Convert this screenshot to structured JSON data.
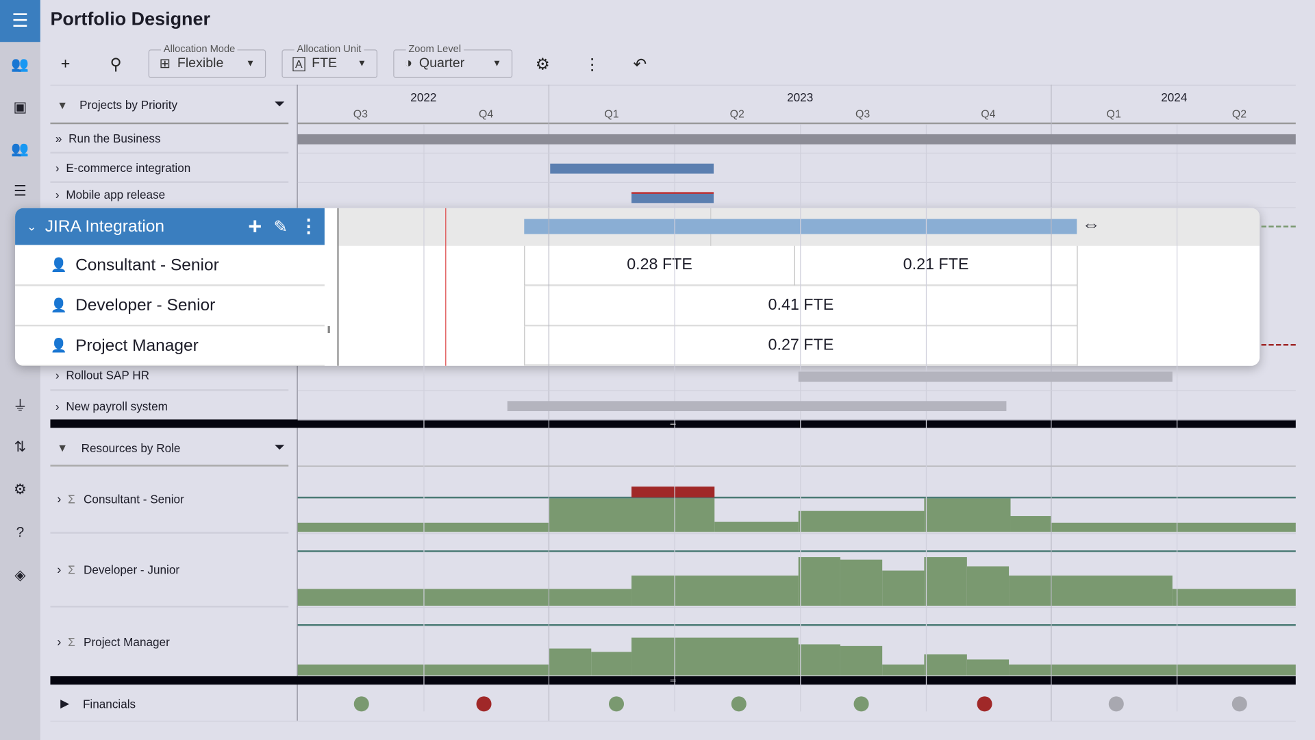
{
  "app": {
    "title": "Portfolio Designer"
  },
  "sidebar": {
    "items": [
      {
        "icon": "menu-icon",
        "glyph": "☰"
      },
      {
        "icon": "user-list-icon",
        "glyph": "👥"
      },
      {
        "icon": "badge-icon",
        "glyph": "▣"
      },
      {
        "icon": "people-icon",
        "glyph": "👥"
      },
      {
        "icon": "list-icon",
        "glyph": "☰"
      },
      {
        "icon": "plug-icon",
        "glyph": "⏚"
      },
      {
        "icon": "sort-icon",
        "glyph": "⇅"
      },
      {
        "icon": "settings-icon",
        "glyph": "⚙"
      },
      {
        "icon": "help-icon",
        "glyph": "?"
      },
      {
        "icon": "compass-icon",
        "glyph": "◈"
      }
    ]
  },
  "toolbar": {
    "add": "+",
    "search": "⚲",
    "settings": "⚙",
    "more": "⋮",
    "undo": "↶",
    "allocation_mode": {
      "label": "Allocation Mode",
      "value": "Flexible"
    },
    "allocation_unit": {
      "label": "Allocation Unit",
      "value": "FTE"
    },
    "zoom_level": {
      "label": "Zoom Level",
      "value": "Quarter"
    }
  },
  "timeline": {
    "years": [
      "2022",
      "2023",
      "2024"
    ],
    "quarters": [
      "Q3",
      "Q4",
      "Q1",
      "Q2",
      "Q3",
      "Q4",
      "Q1",
      "Q2"
    ]
  },
  "projects": {
    "header": "Projects by Priority",
    "items": [
      "Run the Business",
      "E-commerce integration",
      "Mobile app release",
      "Rollout SAP HR",
      "New payroll system"
    ]
  },
  "popup": {
    "project": "JIRA Integration",
    "roles": [
      "Consultant - Senior",
      "Developer - Senior",
      "Project Manager"
    ],
    "values": {
      "consultant_q1": "0.28 FTE",
      "consultant_q2": "0.21 FTE",
      "developer": "0.41 FTE",
      "pm": "0.27 FTE"
    }
  },
  "resources": {
    "header": "Resources by Role",
    "items": [
      "Consultant - Senior",
      "Developer - Junior",
      "Project Manager"
    ]
  },
  "financials": {
    "label": "Financials",
    "status": [
      "green",
      "red",
      "green",
      "green",
      "green",
      "red",
      "gray",
      "gray"
    ]
  },
  "colors": {
    "accent": "#3a7ebf",
    "bar_blue": "#5b7fb0",
    "bar_light_blue": "#8aaed4",
    "load_green": "#7a9970",
    "over_red": "#a02828",
    "status_green": "#7a9970",
    "status_red": "#a02828",
    "status_gray": "#a8a8b0"
  }
}
